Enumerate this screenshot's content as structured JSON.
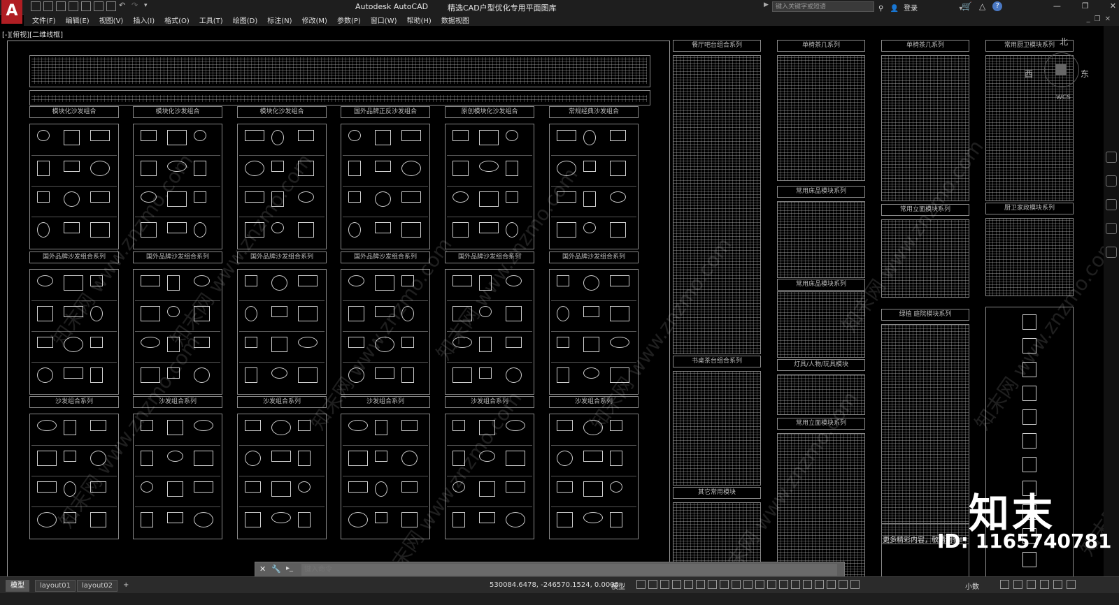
{
  "app": {
    "logo": "A",
    "title": "Autodesk AutoCAD",
    "document": "精选CAD户型优化专用平面图库"
  },
  "search": {
    "placeholder": "键入关键字或短语"
  },
  "account": {
    "login": "登录"
  },
  "menu": [
    "文件(F)",
    "编辑(E)",
    "视图(V)",
    "插入(I)",
    "格式(O)",
    "工具(T)",
    "绘图(D)",
    "标注(N)",
    "修改(M)",
    "参数(P)",
    "窗口(W)",
    "帮助(H)",
    "数据视图"
  ],
  "viewport": {
    "label": "[-][俯视][二维线框]"
  },
  "compass": {
    "north": "北",
    "east": "东",
    "west": "西",
    "wcs": "WCS"
  },
  "drawing": {
    "sofa_sections": [
      "模块化沙发组合",
      "模块化沙发组合",
      "模块化沙发组合",
      "国外品牌正反沙发组合",
      "原创模块化沙发组合",
      "常规经典沙发组合"
    ],
    "sofa_sections_row2": [
      "国外品牌沙发组合系列",
      "国外品牌沙发组合系列",
      "国外品牌沙发组合系列",
      "国外品牌沙发组合系列",
      "国外品牌沙发组合系列",
      "国外品牌沙发组合系列"
    ],
    "sofa_sections_row3": [
      "沙发组合系列",
      "沙发组合系列",
      "沙发组合系列",
      "沙发组合系列",
      "沙发组合系列",
      "沙发组合系列"
    ],
    "right_sections": {
      "dining": "餐厅吧台组合系列",
      "desk": "书桌茶台组合系列",
      "other": "其它常用模块",
      "chair_table": "单椅茶几系列",
      "chair_table2": "单椅茶几系列",
      "bed": "常用床品模块系列",
      "bed2": "常用床品模块系列",
      "lamp": "灯具/人物/玩具模块",
      "elevation": "常用立面模块系列",
      "elevation2": "常用立面模块系列",
      "green": "绿植 庭院模块系列",
      "kitchen": "常用厨卫模块系列",
      "kitchen2": "厨卫家政模块系列"
    },
    "more_text": "更多精彩内容，敬请期待!"
  },
  "watermark": {
    "brand": "知末",
    "id": "ID: 1165740781",
    "tile": "知末网 www.znzmo.com"
  },
  "command": {
    "placeholder": "键入命令"
  },
  "status": {
    "tabs": [
      "模型",
      "layout01",
      "layout02",
      "+"
    ],
    "coords": "530084.6478, -246570.1524, 0.0000",
    "model": "模型",
    "scale": "小数"
  }
}
